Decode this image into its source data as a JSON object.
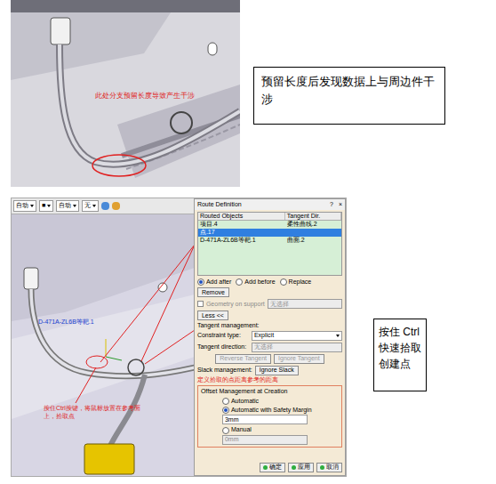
{
  "figure1": {
    "annotation": "此处分支预留长度导致产生干涉",
    "caption": "预留长度后发现数据上与周边件干涉"
  },
  "figure2": {
    "caption": "按住 Ctrl 快速拾取创建点",
    "toolbar": [
      {
        "value": "自动"
      },
      {
        "value": "■"
      },
      {
        "value": "自动"
      },
      {
        "value": "无"
      }
    ],
    "viewer": {
      "part_label": "D-471A-ZL6B等靶.1",
      "annotation": "按住Ctrl按键，将鼠标放置在参考面上，拾取点"
    },
    "dialog": {
      "title": "Route Definition",
      "help": "?",
      "close": "×",
      "columns": [
        "Routed Objects",
        "Tangent Dir."
      ],
      "rows": [
        {
          "object": "项目.4",
          "tangent": "柔性曲线.2",
          "selected": false
        },
        {
          "object": "点.17",
          "tangent": "",
          "selected": true
        },
        {
          "object": "D-471A-ZL6B等靶.1",
          "tangent": "曲面.2",
          "selected": false
        }
      ],
      "insert_modes": [
        {
          "label": "Add after",
          "selected": true
        },
        {
          "label": "Add before",
          "selected": false
        },
        {
          "label": "Replace",
          "selected": false
        }
      ],
      "remove": "Remove",
      "geometry_on_support": {
        "label": "Geometry on support",
        "checked": false,
        "value": "无选择"
      },
      "less": "Less <<",
      "tangent_heading": "Tangent management:",
      "constraint": {
        "label": "Constraint type:",
        "value": "Explicit"
      },
      "tangent_direction": {
        "label": "Tangent direction:",
        "value": "无选择"
      },
      "tangent_buttons": [
        {
          "label": "Reverse Tangent",
          "disabled": true
        },
        {
          "label": "Ignore Tangent",
          "disabled": true
        }
      ],
      "slack": {
        "label": "Slack management:",
        "button": "Ignore Slack"
      },
      "note": "定义拾取的点距离参考的距离",
      "offset": {
        "title": "Offset Management at Creation",
        "options": [
          {
            "label": "Automatic",
            "selected": false,
            "value": "",
            "field_disabled": false
          },
          {
            "label": "Automatic with Safety Margin",
            "selected": true,
            "value": "3mm",
            "field_disabled": false
          },
          {
            "label": "Manual",
            "selected": false,
            "value": "0mm",
            "field_disabled": true
          }
        ]
      },
      "actions": [
        {
          "label": "确定"
        },
        {
          "label": "应用"
        },
        {
          "label": "取消"
        }
      ]
    }
  }
}
